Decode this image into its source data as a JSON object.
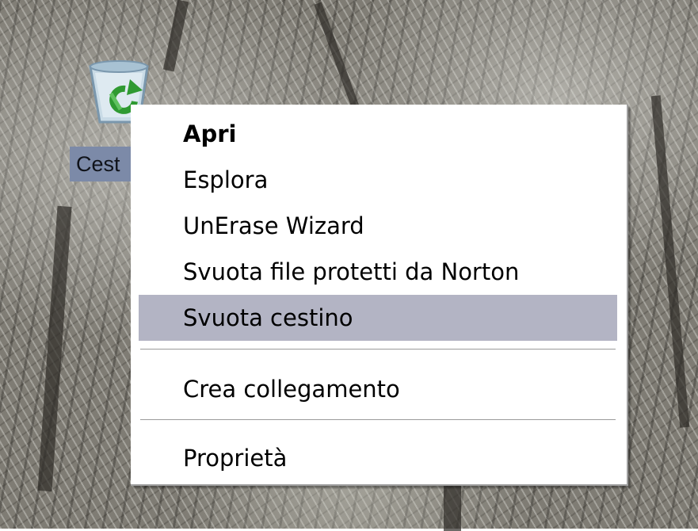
{
  "desktop": {
    "icon": {
      "name": "recycle-bin-icon",
      "label": "Cest"
    }
  },
  "context_menu": {
    "items": [
      {
        "label": "Apri",
        "bold": true
      },
      {
        "label": "Esplora"
      },
      {
        "label": "UnErase Wizard"
      },
      {
        "label": "Svuota file protetti da Norton"
      },
      {
        "label": "Svuota cestino",
        "highlighted": true
      },
      {
        "label": "Crea collegamento"
      },
      {
        "label": "Proprietà"
      }
    ],
    "highlight_color": "#b3b4c4"
  }
}
